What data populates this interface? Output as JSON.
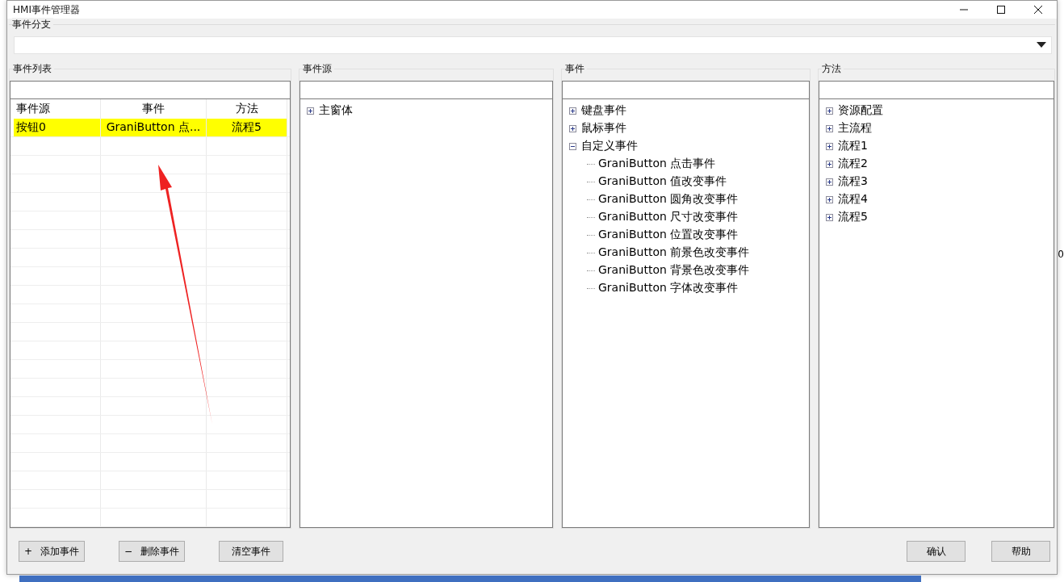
{
  "window": {
    "title": "HMI事件管理器"
  },
  "branch": {
    "label": "事件分支"
  },
  "event_list": {
    "label": "事件列表",
    "columns": [
      "事件源",
      "事件",
      "方法"
    ],
    "rows": [
      {
        "cells": [
          "按钮0",
          "GraniButton 点...",
          "流程5"
        ],
        "selected": true
      }
    ]
  },
  "sources": {
    "label": "事件源",
    "tree": [
      {
        "label": "主窗体",
        "expanded": false
      }
    ]
  },
  "events": {
    "label": "事件",
    "tree": [
      {
        "label": "键盘事件",
        "expanded": false
      },
      {
        "label": "鼠标事件",
        "expanded": false
      },
      {
        "label": "自定义事件",
        "expanded": true,
        "children": [
          {
            "label": "GraniButton 点击事件"
          },
          {
            "label": "GraniButton 值改变事件"
          },
          {
            "label": "GraniButton 圆角改变事件"
          },
          {
            "label": "GraniButton 尺寸改变事件"
          },
          {
            "label": "GraniButton 位置改变事件"
          },
          {
            "label": "GraniButton 前景色改变事件"
          },
          {
            "label": "GraniButton 背景色改变事件"
          },
          {
            "label": "GraniButton 字体改变事件"
          }
        ]
      }
    ]
  },
  "methods": {
    "label": "方法",
    "tree": [
      {
        "label": "资源配置",
        "expanded": false
      },
      {
        "label": "主流程",
        "expanded": false
      },
      {
        "label": "流程1",
        "expanded": false
      },
      {
        "label": "流程2",
        "expanded": false
      },
      {
        "label": "流程3",
        "expanded": false
      },
      {
        "label": "流程4",
        "expanded": false
      },
      {
        "label": "流程5",
        "expanded": false
      }
    ]
  },
  "left_buttons": [
    {
      "icon": "+",
      "label": "添加事件"
    },
    {
      "icon": "−",
      "label": "删除事件"
    },
    {
      "label": "清空事件"
    }
  ],
  "right_buttons": [
    "确认",
    "帮助"
  ],
  "background_fragment": "0"
}
